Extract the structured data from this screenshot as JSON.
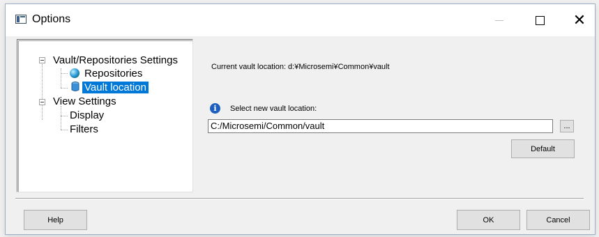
{
  "window": {
    "title": "Options"
  },
  "tree": {
    "items": [
      {
        "label": "Vault/Repositories Settings"
      },
      {
        "label": "Repositories"
      },
      {
        "label": "Vault location",
        "selected": true
      },
      {
        "label": "View Settings"
      },
      {
        "label": "Display"
      },
      {
        "label": "Filters"
      }
    ]
  },
  "main": {
    "current_location": "Current vault location: d:¥Microsemi¥Common¥vault",
    "select_prompt": "Select new vault location:",
    "path_value": "C:/Microsemi/Common/vault",
    "browse_label": "...",
    "default_label": "Default"
  },
  "footer": {
    "help_label": "Help",
    "ok_label": "OK",
    "cancel_label": "Cancel"
  },
  "colors": {
    "selection": "#0078d7",
    "info_icon": "#1c5fbf"
  }
}
